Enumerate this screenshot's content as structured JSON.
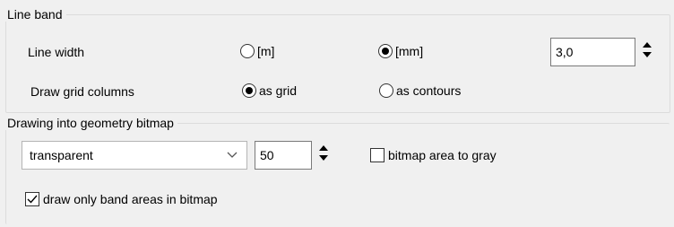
{
  "line_band": {
    "legend": "Line band",
    "line_width_label": "Line width",
    "unit_m": "[m]",
    "unit_mm": "[mm]",
    "selected_unit": "mm",
    "width_value": "3,0",
    "grid_columns_label": "Draw grid columns",
    "as_grid": "as grid",
    "as_contours": "as contours",
    "selected_grid_mode": "as grid"
  },
  "geometry_bitmap": {
    "legend": "Drawing into geometry bitmap",
    "mode_selected": "transparent",
    "transparency_value": "50",
    "bitmap_gray_label": "bitmap area to gray",
    "bitmap_gray_checked": false,
    "band_only_label": "draw only band areas in bitmap",
    "band_only_checked": true
  },
  "icons": {
    "spin_up": "up-arrow-icon",
    "spin_down": "down-arrow-icon",
    "dropdown": "chevron-down-icon",
    "check": "checkmark-icon"
  }
}
